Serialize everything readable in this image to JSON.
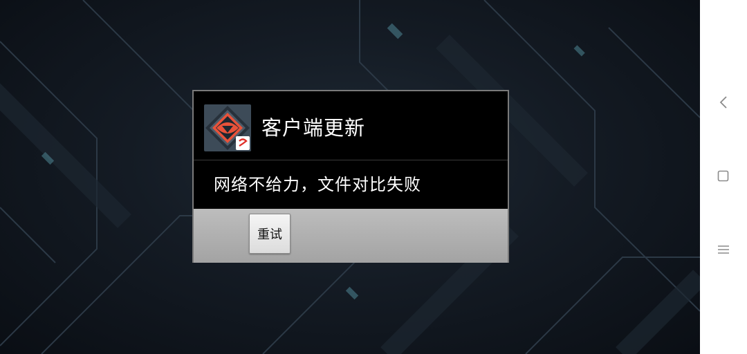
{
  "dialog": {
    "title": "客户端更新",
    "message": "网络不给力，文件对比失败",
    "retry_label": "重试",
    "app_icon": "game-eye-logo-icon",
    "badge_icon": "netease-badge-icon"
  },
  "nav_bar": {
    "buttons": [
      "back-icon",
      "home-square-icon",
      "menu-icon"
    ]
  },
  "colors": {
    "dialog_background": "#000000",
    "footer_background": "#b0b0b0",
    "icon_accent": "#e8523a",
    "game_background": "#141b24"
  }
}
